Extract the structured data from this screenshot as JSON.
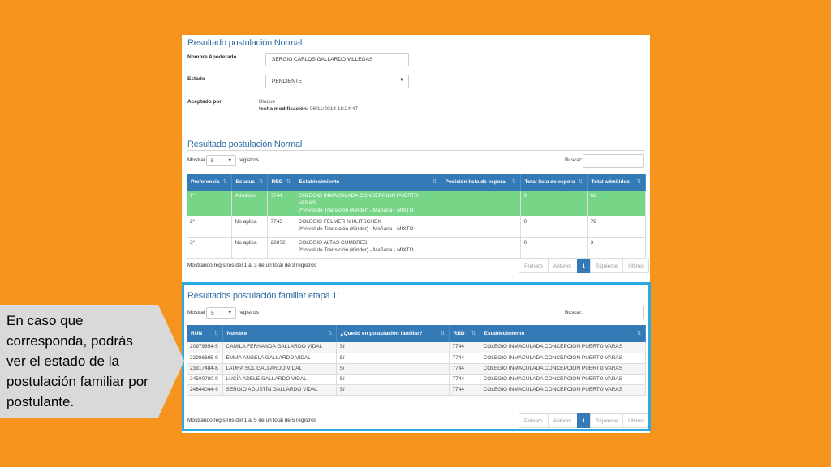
{
  "section1": {
    "title": "Resultado postulación Normal",
    "guardian_label": "Nombre Apoderado",
    "guardian_value": "SERGIO CARLOS GALLARDO VILLEGAS",
    "status_label": "Estado",
    "status_value": "PENDIENTE",
    "accepted_label": "Aceptado por",
    "accepted_value": "Bloque",
    "modified_label": "fecha modificación:",
    "modified_value": "06/11/2018 18:24:47"
  },
  "section2": {
    "title": "Resultado postulación Normal",
    "show_label": "Mostrar",
    "show_value": "5",
    "records_label": "registros",
    "search_label": "Buscar:",
    "columns": [
      "Preferencia",
      "Estatus",
      "RBD",
      "Establecimiento",
      "Posición lista de espera",
      "Total lista de espera",
      "Total admitidos"
    ],
    "rows": [
      {
        "pref": "1º",
        "status": "Admitido",
        "rbd": "7744",
        "school": "COLEGIO INMACULADA CONCEPCION PUERTO VARAS",
        "level": "2º nivel de Transición (Kinder) - Mañana - MIXTO",
        "pos": "",
        "total_wait": "0",
        "total_adm": "62"
      },
      {
        "pref": "2º",
        "status": "No aplica",
        "rbd": "7743",
        "school": "COLEGIO FELMER NIKLITSCHEK",
        "level": "2º nivel de Transición (Kinder) - Mañana - MIXTO",
        "pos": "",
        "total_wait": "0",
        "total_adm": "78"
      },
      {
        "pref": "3º",
        "status": "No aplica",
        "rbd": "22872",
        "school": "COLEGIO ALTAS CUMBRES",
        "level": "2º nivel de Transición (Kinder) - Mañana - MIXTO",
        "pos": "",
        "total_wait": "0",
        "total_adm": "3"
      }
    ],
    "info": "Mostrando registros del 1 al 3 de un total de 3 registros",
    "pager": {
      "first": "Primero",
      "prev": "Anterior",
      "page": "1",
      "next": "Siguiente",
      "last": "Último"
    }
  },
  "section3": {
    "title": "Resultados postulación familiar etapa 1:",
    "show_label": "Mostrar",
    "show_value": "5",
    "records_label": "registros",
    "search_label": "Buscar:",
    "columns": [
      "RUN",
      "Nombre",
      "¿Quedó en postulación familiar?",
      "RBD",
      "Establecimiento"
    ],
    "rows": [
      {
        "run": "20979854-5",
        "name": "CAMILA FERNANDA GALLARDO VIDAL",
        "result": "Sí",
        "rbd": "7744",
        "school": "COLEGIO INMACULADA CONCEPCION PUERTO VARAS"
      },
      {
        "run": "22986695-9",
        "name": "EMMA ANGELA GALLARDO VIDAL",
        "result": "Sí",
        "rbd": "7744",
        "school": "COLEGIO INMACULADA CONCEPCION PUERTO VARAS"
      },
      {
        "run": "23317484-K",
        "name": "LAURA SOL GALLARDO VIDAL",
        "result": "Sí",
        "rbd": "7744",
        "school": "COLEGIO INMACULADA CONCEPCION PUERTO VARAS"
      },
      {
        "run": "24500780-9",
        "name": "LUCÍA ADELE GALLARDO VIDAL",
        "result": "Sí",
        "rbd": "7744",
        "school": "COLEGIO INMACULADA CONCEPCION PUERTO VARAS"
      },
      {
        "run": "24844044-9",
        "name": "SERGIO AGUSTÍN GALLARDO VIDAL",
        "result": "Sí",
        "rbd": "7744",
        "school": "COLEGIO INMACULADA CONCEPCION PUERTO VARAS"
      }
    ],
    "info": "Mostrando registros del 1 al 5 de un total de 5 registros",
    "pager": {
      "first": "Primero",
      "prev": "Anterior",
      "page": "1",
      "next": "Siguiente",
      "last": "Último"
    }
  },
  "callout": {
    "text": "En caso que corresponda, podrás ver el estado de la postulación familiar por postulante."
  },
  "colors": {
    "background": "#F7941D",
    "header_blue": "#337AB7",
    "admitted_green": "#77D587",
    "highlight_border": "#29ABE2",
    "callout_fill": "#D9D9D9"
  }
}
